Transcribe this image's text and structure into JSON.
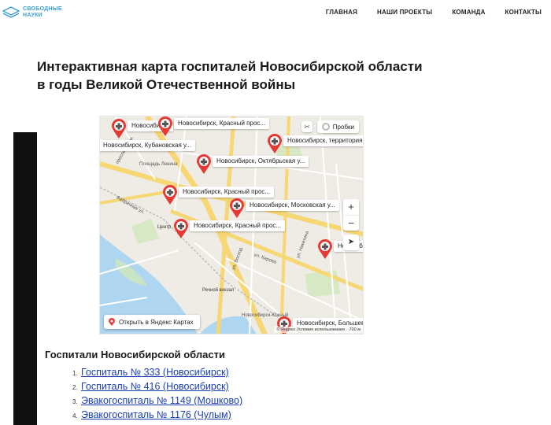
{
  "header": {
    "logo": {
      "line1": "СВОБОДНЫЕ",
      "line2": "НАУКИ"
    },
    "nav": [
      "ГЛАВНАЯ",
      "НАШИ ПРОЕКТЫ",
      "КОМАНДА",
      "КОНТАКТЫ"
    ]
  },
  "page": {
    "title_line1": "Интерактивная карта госпиталей Новосибирской области",
    "title_line2": "в годы Великой Отечественной войны"
  },
  "map": {
    "traffic_label": "Пробки",
    "open_button": "Открыть в Яндекс Картах",
    "copyright": "© Яндекс  Условия использования",
    "scale": "700 м",
    "pins": [
      "Новосибирск",
      "Новосибирск, Красный прос...",
      "Новосибирск, Кубановская у...",
      "Новосибирск, территория В...",
      "Новосибирск, Октябрьская у...",
      "Новосибирск, Красный прос...",
      "Новосибирск, Московская у...",
      "Новосибирск, Красный прос...",
      "Новосибирск",
      "Новосибирск, Большевис..."
    ],
    "street_labels": [
      "Площадь Ленина",
      "Центр",
      "Речной вокзал",
      "Новосибирск-Южный",
      "ул. Восход",
      "ул. Кирова",
      "ул. Никитина",
      "проспект Дим.",
      "Фабричная ул."
    ],
    "accent": "#e53935"
  },
  "list": {
    "title": "Госпитали Новосибирской области",
    "items": [
      {
        "num": "1.",
        "label": "Госпиталь № 333 (Новосибирск)"
      },
      {
        "num": "2.",
        "label": "Госпиталь № 416 (Новосибирск)"
      },
      {
        "num": "3.",
        "label": "Эвакогоспиталь № 1149 (Мошково)"
      },
      {
        "num": "4.",
        "label": "Эвакогоспиталь № 1176 (Чулым)"
      }
    ]
  }
}
